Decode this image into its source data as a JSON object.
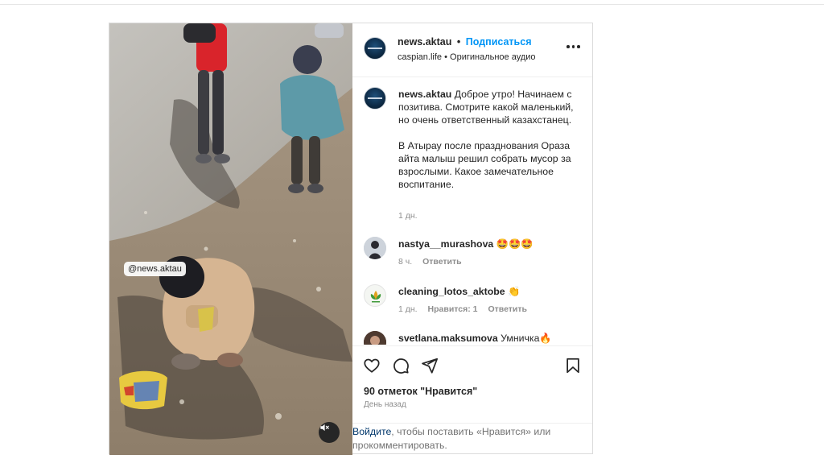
{
  "post": {
    "watermark": "@news.aktau",
    "header": {
      "username": "news.aktau",
      "separator": "•",
      "follow_label": "Подписаться",
      "location": "caspian.life",
      "sub_separator": "•",
      "audio": "Оригинальное аудио",
      "more_icon": "more-horizontal-icon"
    },
    "caption": {
      "username": "news.aktau",
      "paragraph1": "Доброе утро! Начинаем с позитива. Смотрите какой маленький, но очень ответственный казахстанец.",
      "paragraph2": "В Атырау после празднования Ораза айта малыш решил собрать мусор за взрослыми. Какое замечательное воспитание.",
      "time": "1 дн."
    },
    "comments": [
      {
        "username": "nastya__murashova",
        "text": "🤩🤩🤩",
        "time": "8 ч.",
        "likes": "",
        "reply": "Ответить"
      },
      {
        "username": "cleaning_lotos_aktobe",
        "text": "👏",
        "time": "1 дн.",
        "likes": "Нравится: 1",
        "reply": "Ответить"
      },
      {
        "username": "svetlana.maksumova",
        "text": "Умничка🔥",
        "time": "",
        "likes": "",
        "reply": ""
      }
    ],
    "likes_text": "90 отметок \"Нравится\"",
    "date_text": "День назад",
    "login_link": "Войдите",
    "login_rest": ", чтобы поставить «Нравится» или прокомментировать.",
    "colors": {
      "link_blue": "#0095f6",
      "text": "#262626",
      "muted": "#8e8e8e",
      "border": "#dbdbdb"
    }
  }
}
